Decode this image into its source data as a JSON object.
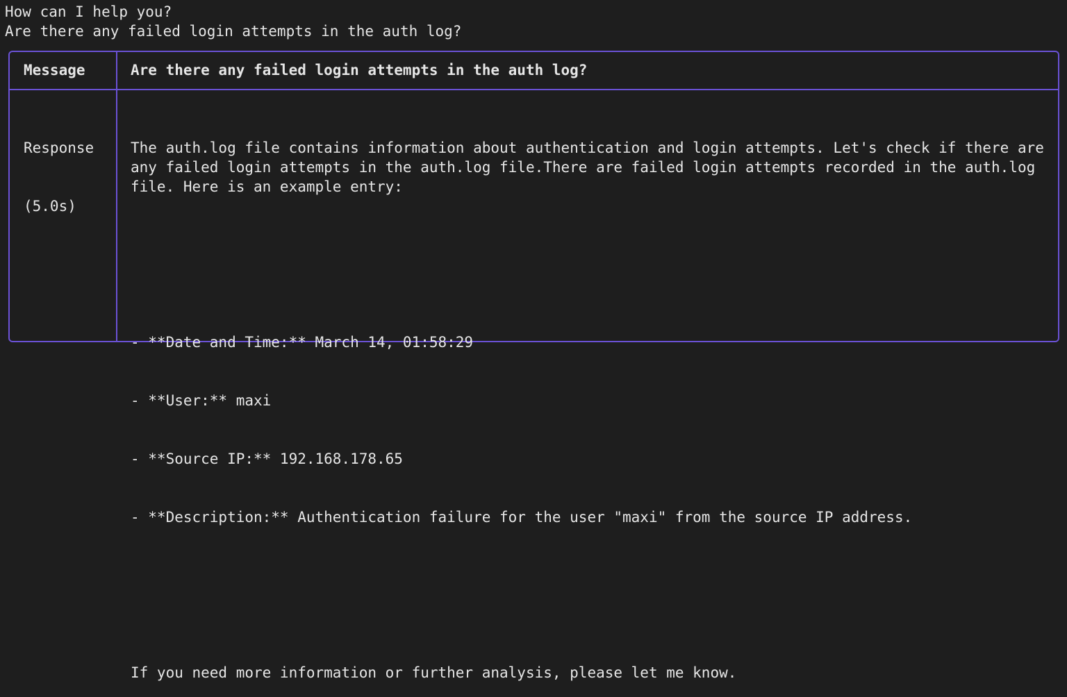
{
  "prompt": {
    "question": "How can I help you?",
    "user_input": "Are there any failed login attempts in the auth log?"
  },
  "table": {
    "message_label": "Message",
    "message_value": "Are there any failed login attempts in the auth log?",
    "response_label": "Response",
    "response_time": "(5.0s)",
    "response_intro": "The auth.log file contains information about authentication and login attempts. Let's check if there are any failed login attempts in the auth.log file.There are failed login attempts recorded in the auth.log file. Here is an example entry:",
    "response_items": [
      "- **Date and Time:** March 14, 01:58:29",
      "- **User:** maxi",
      "- **Source IP:** 192.168.178.65",
      "- **Description:** Authentication failure for the user \"maxi\" from the source IP address."
    ],
    "response_outro": "If you need more information or further analysis, please let me know."
  },
  "colors": {
    "background": "#1e1e1e",
    "text": "#e6e6e6",
    "border": "#6b52d6"
  }
}
